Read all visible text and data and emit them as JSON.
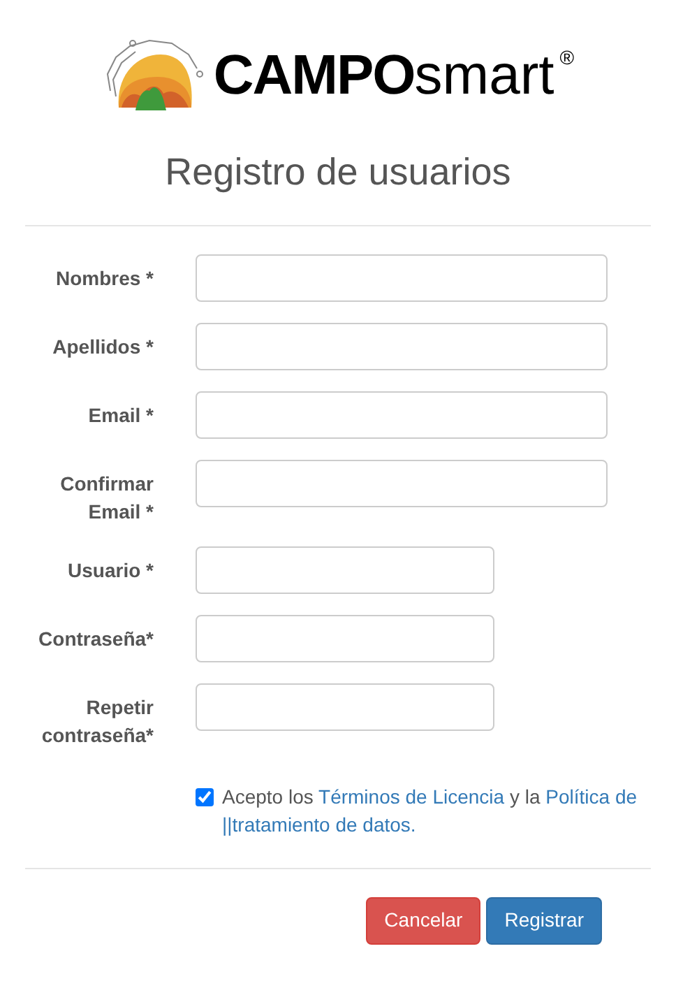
{
  "logo": {
    "brand_bold": "CAMPO",
    "brand_light": "smart",
    "registered": "®"
  },
  "title": "Registro de usuarios",
  "fields": [
    {
      "label": "Nombres *",
      "kind": "wide"
    },
    {
      "label": "Apellidos *",
      "kind": "wide"
    },
    {
      "label": "Email *",
      "kind": "wide"
    },
    {
      "label": "Confirmar Email *",
      "kind": "wide"
    },
    {
      "label": "Usuario *",
      "kind": "narrow"
    },
    {
      "label": "Contraseña*",
      "kind": "narrow"
    },
    {
      "label": "Repetir contraseña*",
      "kind": "narrow"
    }
  ],
  "agreement": {
    "checked": true,
    "parts": [
      {
        "kind": "text",
        "text": "Acepto los"
      },
      {
        "kind": "link",
        "text": "Términos de Licencia"
      },
      {
        "kind": "text",
        "text": "y la"
      },
      {
        "kind": "link",
        "text": "Política de"
      },
      {
        "kind": "link",
        "text": "||tratamiento de datos."
      }
    ]
  },
  "buttons": [
    {
      "label": "Cancelar",
      "kind": "danger"
    },
    {
      "label": "Registrar",
      "kind": "primary"
    }
  ]
}
